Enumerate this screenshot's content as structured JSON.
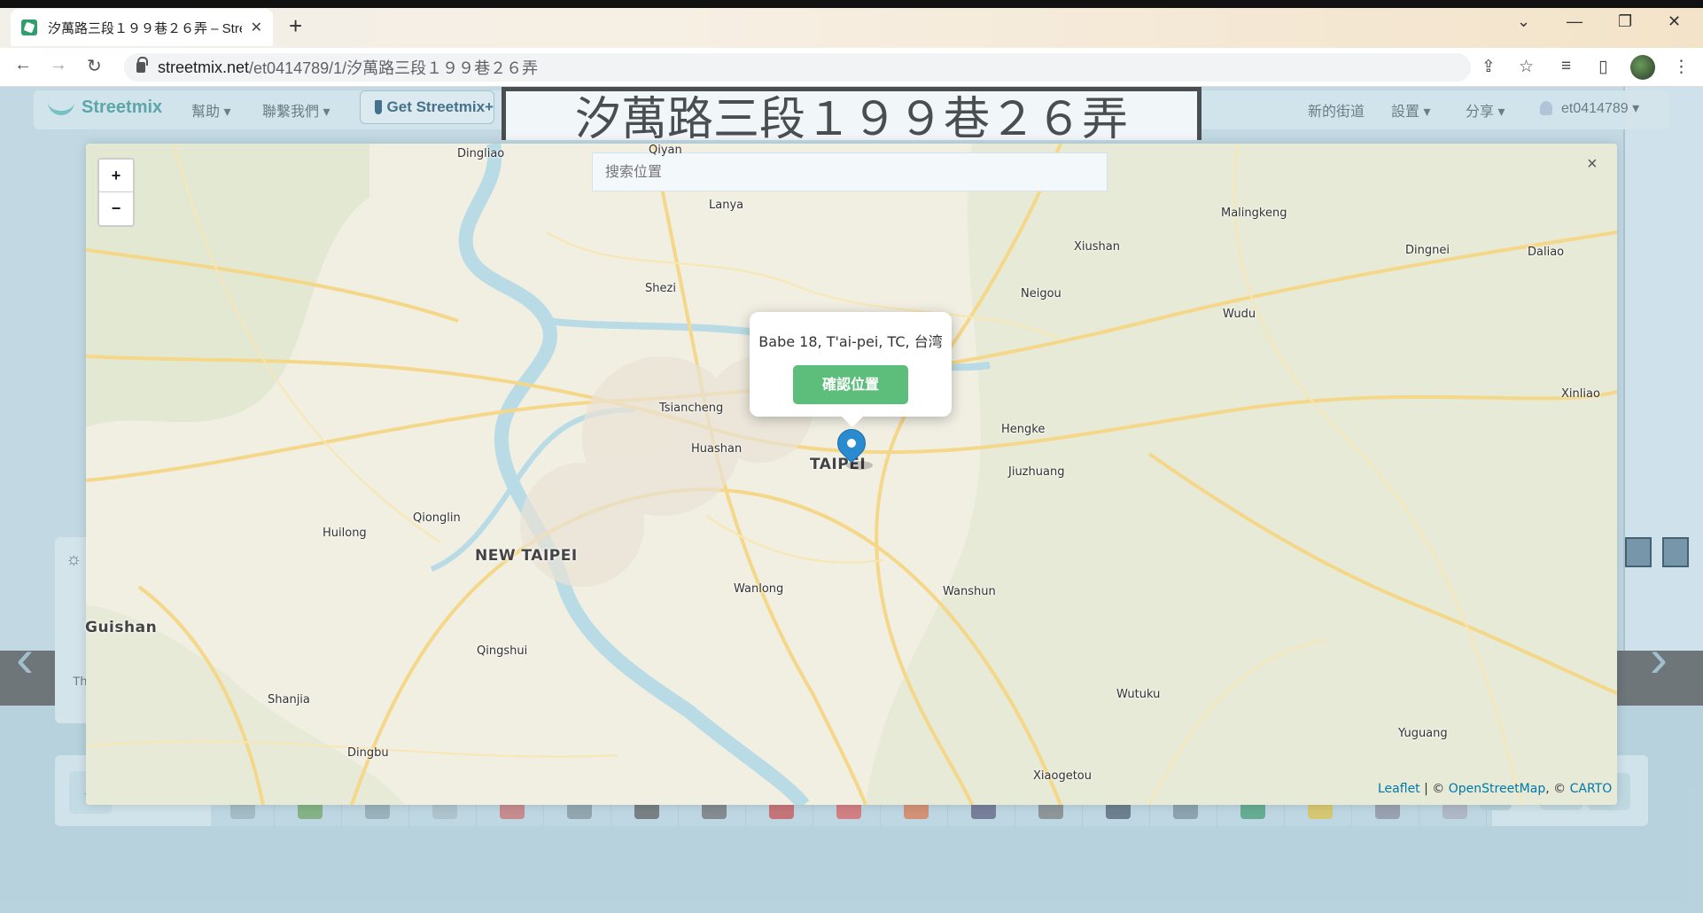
{
  "browser": {
    "tab_title": "汐萬路三段１９９巷２６弄 – Stre",
    "url_host": "streetmix.net",
    "url_path": "/et0414789/1/汐萬路三段１９９巷２６弄"
  },
  "app": {
    "logo": "Streetmix",
    "menu_help": "幫助 ▾",
    "menu_contact": "聯繫我們 ▾",
    "get_plus": "Get Streetmix+",
    "street_name": "汐萬路三段１９９巷２６弄",
    "menu_new": "新的街道",
    "menu_settings": "設置 ▾",
    "menu_share": "分享 ▾",
    "user": "et0414789 ▾",
    "left_text": "Th"
  },
  "map": {
    "search_placeholder": "搜索位置",
    "popup_address": "Babe 18, T'ai-pei, TC, 台湾",
    "confirm_label": "確認位置",
    "zoom_in": "+",
    "zoom_out": "−",
    "close": "×",
    "attribution": {
      "leaflet": "Leaflet",
      "sep1": " | © ",
      "osm": "OpenStreetMap",
      "sep2": ", © ",
      "carto": "CARTO"
    },
    "places": [
      {
        "name": "Dingliao",
        "cls": "place"
      },
      {
        "name": "Lanya",
        "cls": "place"
      },
      {
        "name": "Qiyan",
        "cls": "place"
      },
      {
        "name": "Malingkeng",
        "cls": "place"
      },
      {
        "name": "Xiushan",
        "cls": "place"
      },
      {
        "name": "Dingnei",
        "cls": "place"
      },
      {
        "name": "Daliao",
        "cls": "place"
      },
      {
        "name": "Shezi",
        "cls": "place"
      },
      {
        "name": "Neigou",
        "cls": "place"
      },
      {
        "name": "Wudu",
        "cls": "place"
      },
      {
        "name": "Xinliao",
        "cls": "place"
      },
      {
        "name": "Tsiancheng",
        "cls": "place"
      },
      {
        "name": "Huashan",
        "cls": "place"
      },
      {
        "name": "Hengke",
        "cls": "place"
      },
      {
        "name": "TAIPEI",
        "cls": "place big"
      },
      {
        "name": "Jiuzhuang",
        "cls": "place"
      },
      {
        "name": "Huilong",
        "cls": "place"
      },
      {
        "name": "Qionglin",
        "cls": "place"
      },
      {
        "name": "NEW TAIPEI",
        "cls": "place big"
      },
      {
        "name": "Guishan",
        "cls": "place big"
      },
      {
        "name": "Wanlong",
        "cls": "place"
      },
      {
        "name": "Wanshun",
        "cls": "place"
      },
      {
        "name": "Qingshui",
        "cls": "place"
      },
      {
        "name": "Shanjia",
        "cls": "place"
      },
      {
        "name": "Wutuku",
        "cls": "place"
      },
      {
        "name": "Yuguang",
        "cls": "place"
      },
      {
        "name": "Dingbu",
        "cls": "place"
      },
      {
        "name": "Xiaogetou",
        "cls": "place"
      }
    ]
  },
  "palette": {
    "items": [
      "people-segment",
      "tree-segment",
      "bike-segment",
      "bench-segment",
      "cafe-segment",
      "kiosk-segment",
      "lamp-segment",
      "pole-segment",
      "planter-segment",
      "flowers-segment",
      "cone-segment",
      "pedestrian-segment",
      "scooter-segment",
      "cyclist-segment",
      "bikeshare-segment",
      "bus-segment",
      "taxi-segment",
      "sign-segment",
      "car-segment"
    ]
  },
  "colors": {
    "accent": "#5dbd7a",
    "road_yellow": "#f5d789",
    "water": "#b8dbe6",
    "pin": "#2a8bd0"
  }
}
